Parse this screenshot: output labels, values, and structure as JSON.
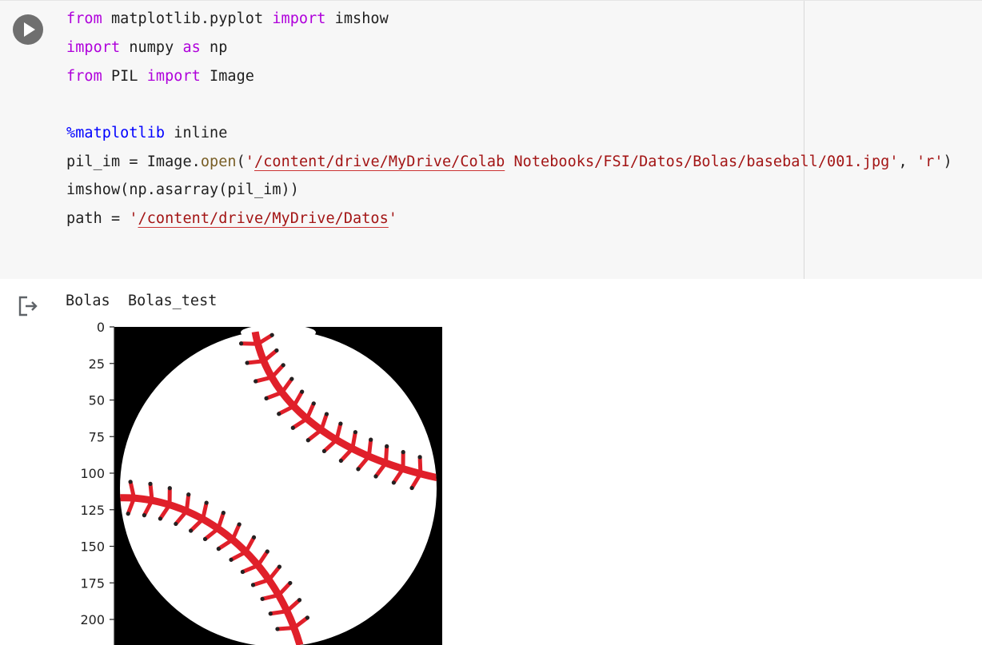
{
  "code": {
    "line1": {
      "kw1": "from",
      "t1": " matplotlib.pyplot ",
      "kw2": "import",
      "t2": " imshow"
    },
    "line2": {
      "kw1": "import",
      "t1": " numpy ",
      "kw2": "as",
      "t2": " np"
    },
    "line3": {
      "kw1": "from",
      "t1": " PIL ",
      "kw2": "import",
      "t2": " Image"
    },
    "line4": {
      "magic": "%matplotlib",
      "t1": " inline"
    },
    "line5": {
      "t1": "pil_im = Image.",
      "fn": "open",
      "t2": "(",
      "s1": "'",
      "s1u": "/content/drive/MyDrive/Colab",
      "s2": " Notebooks/FSI/Datos/Bolas/baseball/001.jpg'",
      "t3": ", ",
      "s3": "'r'",
      "t4": ")"
    },
    "line6": {
      "t1": "imshow(np.asarray(pil_im))"
    },
    "line7": {
      "t1": "path = ",
      "s1": "'",
      "s1u": "/content/drive/MyDrive/Datos",
      "s2": "'"
    }
  },
  "output": {
    "text": "Bolas  Bolas_test"
  },
  "chart_data": {
    "type": "image",
    "ylabel_ticks": [
      "0",
      "25",
      "50",
      "75",
      "100",
      "125",
      "150",
      "175",
      "200"
    ],
    "yticks": [
      0,
      25,
      50,
      75,
      100,
      125,
      150,
      175,
      200
    ],
    "ylim": [
      0,
      215
    ],
    "colors": {
      "background": "#000000",
      "ball": "#ffffff",
      "stitch": "#e0202a",
      "stitch_dot": "#222222"
    }
  },
  "icons": {
    "run": "play-icon",
    "output": "output-icon"
  }
}
